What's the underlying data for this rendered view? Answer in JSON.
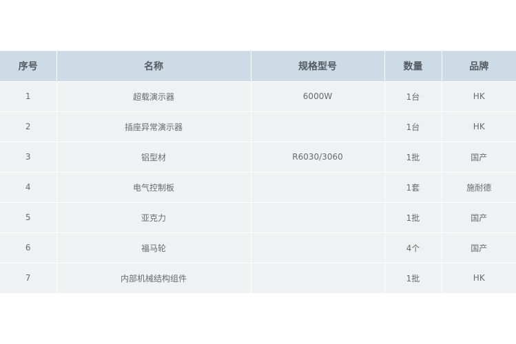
{
  "table": {
    "headers": [
      "序号",
      "名称",
      "规格型号",
      "数量",
      "品牌"
    ],
    "rows": [
      [
        "1",
        "超载演示器",
        "6000W",
        "1台",
        "HK"
      ],
      [
        "2",
        "插座异常演示器",
        "",
        "1台",
        "HK"
      ],
      [
        "3",
        "铝型材",
        "R6030/3060",
        "1批",
        "国产"
      ],
      [
        "4",
        "电气控制板",
        "",
        "1套",
        "施耐德"
      ],
      [
        "5",
        "亚克力",
        "",
        "1批",
        "国产"
      ],
      [
        "6",
        "福马轮",
        "",
        "4个",
        "国产"
      ],
      [
        "7",
        "内部机械结构组件",
        "",
        "1批",
        "HK"
      ]
    ]
  },
  "colors": {
    "header_bg": "#cddbe7",
    "row_bg": "#f0f1f2",
    "header_text": "#555b61",
    "cell_text": "#666a6e"
  }
}
